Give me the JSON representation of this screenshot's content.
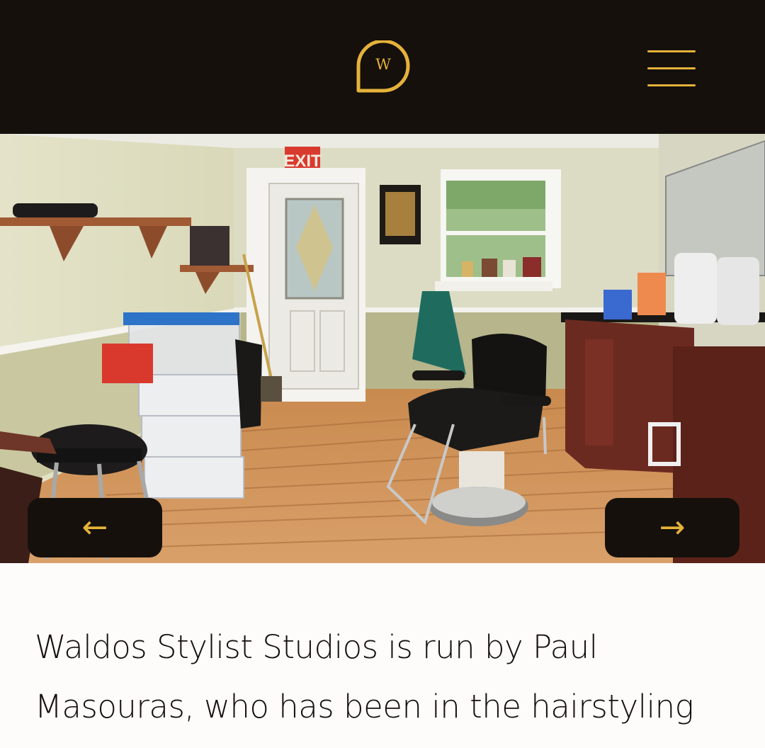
{
  "header": {
    "logo_letter": "W",
    "logo_icon": "speech-bubble-logo",
    "menu_icon": "hamburger-menu-icon"
  },
  "hero": {
    "exit_sign": "EXIT",
    "prev_icon": "arrow-left-icon",
    "next_icon": "arrow-right-icon",
    "prev_symbol": "←",
    "next_symbol": "→"
  },
  "intro": {
    "text": "Waldos Stylist Studios is run by Paul Masouras, who has been in the hairstyling"
  },
  "colors": {
    "header_bg": "#15100c",
    "accent": "#e5b23a",
    "page_bg": "#fdfcfb",
    "text": "#15100c"
  }
}
